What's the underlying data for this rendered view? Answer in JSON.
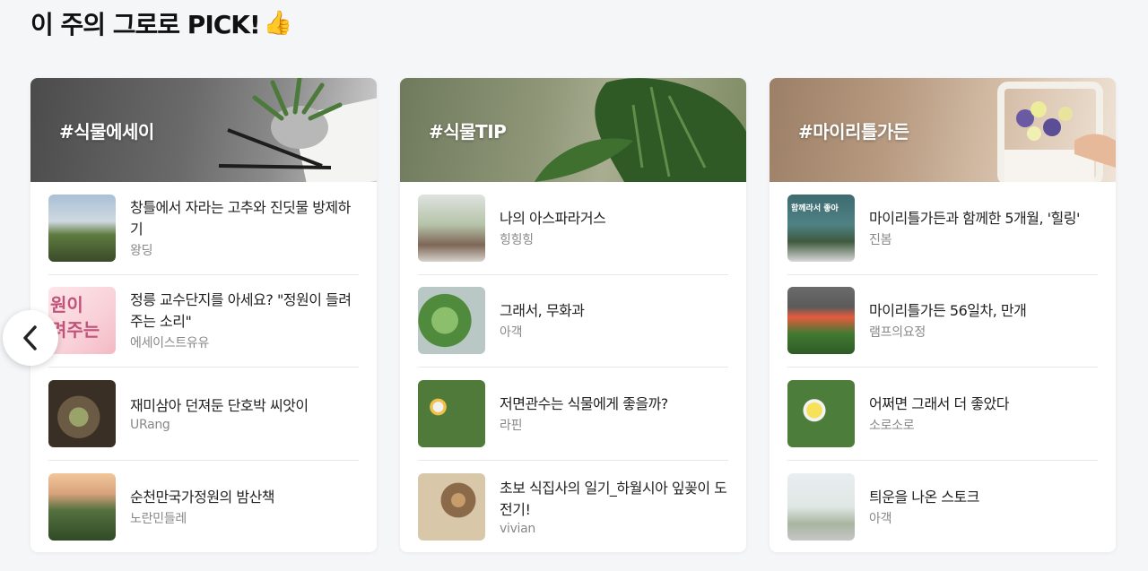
{
  "section": {
    "title": "이 주의 그로로 PICK!",
    "emoji": "👍"
  },
  "nav": {
    "prev_icon": "chevron-left-icon"
  },
  "cards": [
    {
      "tag": "#식물에세이",
      "items": [
        {
          "title": "창틀에서 자라는 고추와 진딧물 방제하기",
          "author": "왕딩"
        },
        {
          "title": "정릉 교수단지를 아세요? \"정원이 들려주는 소리\"",
          "author": "에세이스트유유",
          "thumb_text": "원이\n려주는"
        },
        {
          "title": "재미삼아 던져둔 단호박 씨앗이",
          "author": "URang"
        },
        {
          "title": "순천만국가정원의 밤산책",
          "author": "노란민들레"
        }
      ]
    },
    {
      "tag": "#식물TIP",
      "items": [
        {
          "title": "나의 아스파라거스",
          "author": "힝힝힝"
        },
        {
          "title": "그래서, 무화과",
          "author": "아객"
        },
        {
          "title": "저면관수는 식물에게 좋을까?",
          "author": "라핀"
        },
        {
          "title": "초보 식집사의 일기_하월시아 잎꽂이 도전기!",
          "author": "vivian"
        }
      ]
    },
    {
      "tag": "#마이리틀가든",
      "items": [
        {
          "title": "마이리틀가든과 함께한 5개월, '힐링'",
          "author": "진봄",
          "thumb_text": "함께라서 좋아"
        },
        {
          "title": "마이리틀가든 56일차, 만개",
          "author": "램프의요정"
        },
        {
          "title": "어쩌면 그래서 더 좋았다",
          "author": "소로소로"
        },
        {
          "title": "틔운을 나온 스토크",
          "author": "아객"
        }
      ]
    }
  ]
}
